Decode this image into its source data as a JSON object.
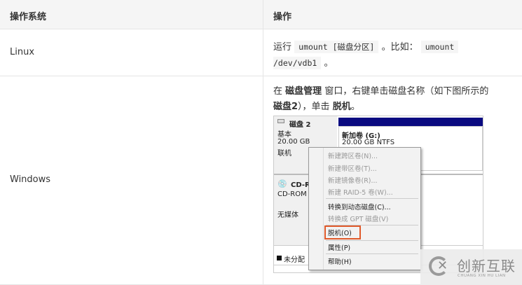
{
  "table": {
    "headers": [
      "操作系统",
      "操作"
    ],
    "rows": [
      {
        "os": "Linux",
        "run": "运行",
        "cmd1": "umount [磁盘分区]",
        "mid": "。比如：",
        "cmd2a": "umount",
        "cmd2b": "/dev/vdb1",
        "end": "。"
      },
      {
        "os": "Windows",
        "t1": "在",
        "b1": "磁盘管理",
        "t2": "窗口，右键单击磁盘名称（如下图所示的",
        "b2": "磁盘2",
        "t3": "），单击",
        "b3": "脱机",
        "t4": "。"
      }
    ]
  },
  "screenshot": {
    "disk": {
      "name": "磁盘 2",
      "type": "基本",
      "size": "20.00 GB",
      "status": "联机"
    },
    "volume": {
      "name": "新加卷 (G:)",
      "size": "20.00 GB NTFS"
    },
    "cdrom": {
      "name": "CD-R",
      "type": "CD-ROM",
      "media": "无媒体"
    },
    "legend": "未分配",
    "menu": [
      {
        "label": "新建跨区卷(N)...",
        "disabled": true
      },
      {
        "label": "新建带区卷(T)...",
        "disabled": true
      },
      {
        "label": "新建镜像卷(R)...",
        "disabled": true
      },
      {
        "label": "新建 RAID-5 卷(W)...",
        "disabled": true
      },
      {
        "label": "转换到动态磁盘(C)...",
        "disabled": false
      },
      {
        "label": "转换成 GPT 磁盘(V)",
        "disabled": true
      },
      {
        "label": "脱机(O)",
        "disabled": false,
        "highlighted": true
      },
      {
        "label": "属性(P)",
        "disabled": false
      },
      {
        "label": "帮助(H)",
        "disabled": false
      }
    ],
    "highlight_color": "#e05a2b",
    "bar_color": "#0a0a80"
  },
  "watermark": {
    "text": "创新互联",
    "sub": "CHUANG XIN HU LIAN"
  }
}
